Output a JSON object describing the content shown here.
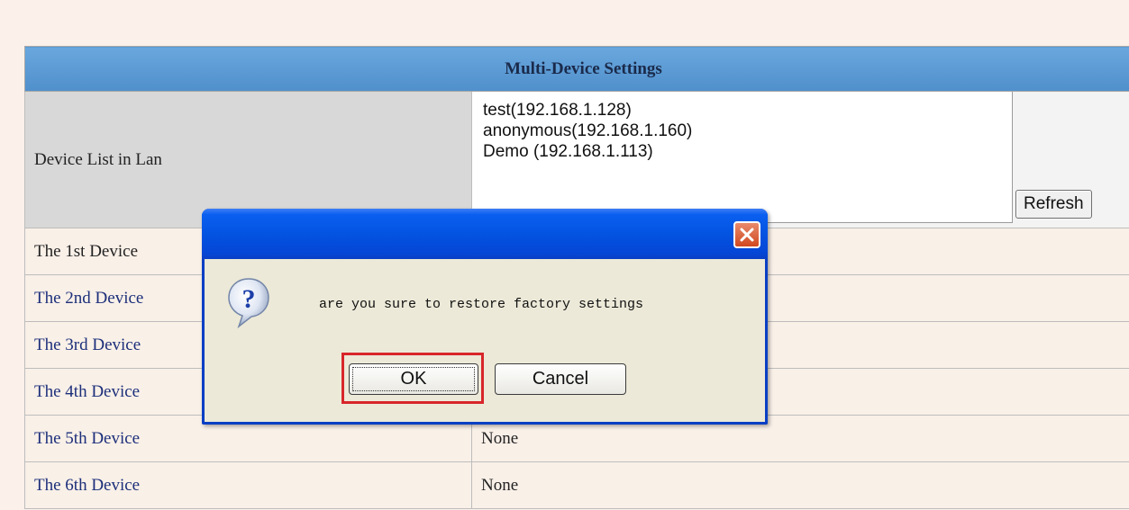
{
  "settings": {
    "title": "Multi-Device Settings",
    "device_list_label": "Device List in Lan",
    "lan_devices": [
      "test(192.168.1.128)",
      "anonymous(192.168.1.160)",
      "Demo (192.168.1.113)"
    ],
    "refresh_label": "Refresh",
    "devices": [
      {
        "label": "The 1st Device",
        "value": ""
      },
      {
        "label": "The 2nd Device",
        "value": ""
      },
      {
        "label": "The 3rd Device",
        "value": ""
      },
      {
        "label": "The 4th Device",
        "value": ""
      },
      {
        "label": "The 5th Device",
        "value": "None"
      },
      {
        "label": "The 6th Device",
        "value": "None"
      }
    ]
  },
  "dialog": {
    "icon": "question-icon",
    "message": "are you sure to restore factory settings",
    "ok_label": "OK",
    "cancel_label": "Cancel"
  },
  "colors": {
    "header_bar": "#5b9bd5",
    "dialog_title": "#0453e1",
    "highlight": "#d8262a"
  }
}
